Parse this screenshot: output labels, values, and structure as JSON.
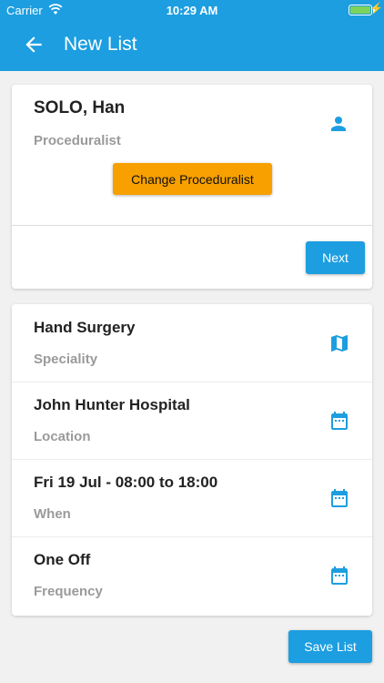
{
  "status_bar": {
    "carrier": "Carrier",
    "time": "10:29 AM",
    "battery_level": 1.0
  },
  "header": {
    "title": "New List",
    "back_icon": "arrow-left-icon"
  },
  "proceduralist": {
    "name": "SOLO, Han",
    "role": "Proceduralist",
    "icon": "person-icon",
    "change_label": "Change Proceduralist",
    "next_label": "Next"
  },
  "details": [
    {
      "value": "Hand Surgery",
      "label": "Speciality",
      "icon": "map-icon"
    },
    {
      "value": "John Hunter Hospital",
      "label": "Location",
      "icon": "calendar-icon"
    },
    {
      "value": "Fri 19 Jul - 08:00 to 18:00",
      "label": "When",
      "icon": "calendar-icon"
    },
    {
      "value": "One Off",
      "label": "Frequency",
      "icon": "calendar-icon"
    }
  ],
  "save_label": "Save List",
  "colors": {
    "primary": "#1c9ee0",
    "accent": "#f7a000",
    "background": "#f1f1f1"
  }
}
